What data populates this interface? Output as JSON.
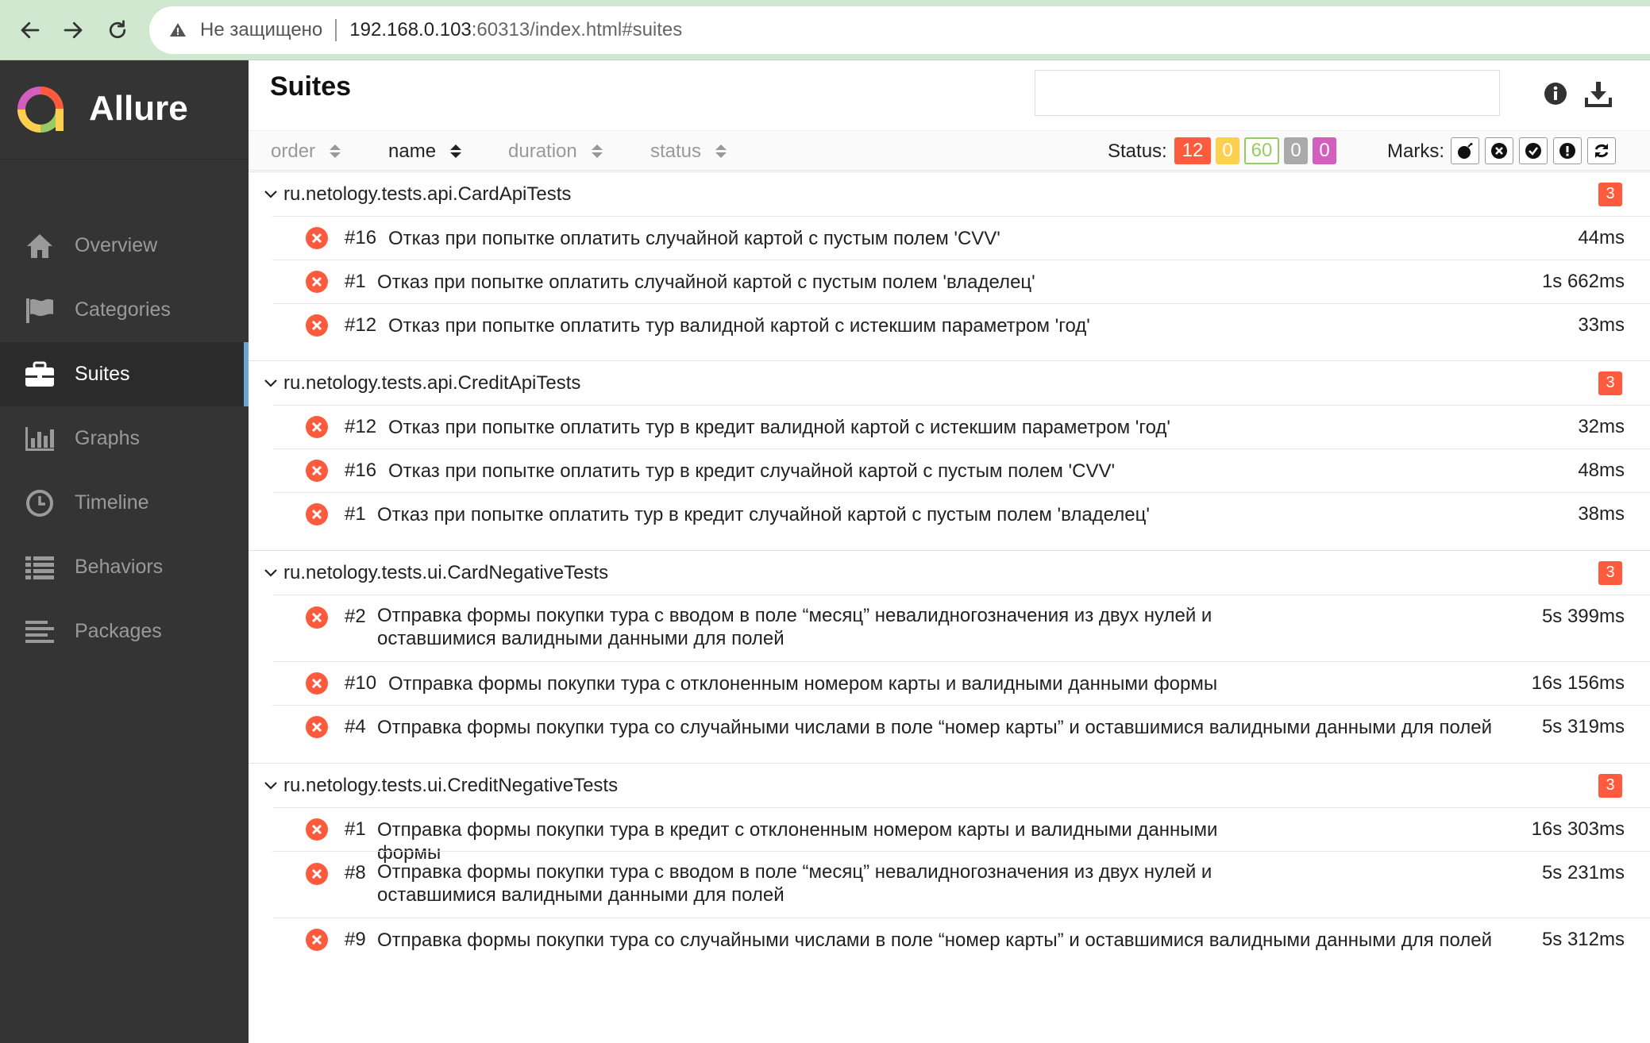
{
  "browser": {
    "not_secure": "Не защищено",
    "url_host": "192.168.0.103",
    "url_rest": ":60313/index.html#suites",
    "icons": [
      "back-icon",
      "forward-icon",
      "reload-icon",
      "warning-icon"
    ]
  },
  "sidebar": {
    "brand": "Allure",
    "items": [
      {
        "label": "Overview",
        "icon": "home-icon"
      },
      {
        "label": "Categories",
        "icon": "flag-icon"
      },
      {
        "label": "Suites",
        "icon": "briefcase-icon"
      },
      {
        "label": "Graphs",
        "icon": "bar-chart-icon"
      },
      {
        "label": "Timeline",
        "icon": "clock-icon"
      },
      {
        "label": "Behaviors",
        "icon": "list-icon"
      },
      {
        "label": "Packages",
        "icon": "align-left-icon"
      }
    ],
    "active": "Suites"
  },
  "header": {
    "title": "Suites",
    "search_value": "",
    "icons": [
      "info-icon",
      "download-icon"
    ]
  },
  "toolbar": {
    "sort": [
      {
        "label": "order"
      },
      {
        "label": "name"
      },
      {
        "label": "duration"
      },
      {
        "label": "status"
      }
    ],
    "active_sort": "name",
    "status_label": "Status:",
    "status_badges": [
      {
        "value": "12",
        "kind": "failed",
        "bg": "#fd5a3e",
        "fg": "#ffffff"
      },
      {
        "value": "0",
        "kind": "broken",
        "bg": "#ffd050",
        "fg": "#ffffff"
      },
      {
        "value": "60",
        "kind": "passed",
        "bg": "#ffffff",
        "fg": "#97cc64",
        "border": "#97cc64"
      },
      {
        "value": "0",
        "kind": "skipped",
        "bg": "#aaaaaa",
        "fg": "#ffffff"
      },
      {
        "value": "0",
        "kind": "unknown",
        "bg": "#d35ebe",
        "fg": "#ffffff"
      }
    ],
    "marks_label": "Marks:",
    "marks": [
      "bomb-icon",
      "times-circle-icon",
      "check-circle-icon",
      "exclamation-circle-icon",
      "refresh-icon"
    ]
  },
  "suites": [
    {
      "name": "ru.netology.tests.api.CardApiTests",
      "count": "3",
      "tests": [
        {
          "order": "#16",
          "name": "Отказ при попытке оплатить случайной картой с пустым полем 'CVV'",
          "duration": "44ms"
        },
        {
          "order": "#1",
          "name": "Отказ при попытке оплатить случайной картой с пустым полем 'владелец'",
          "duration": "1s 662ms"
        },
        {
          "order": "#12",
          "name": "Отказ при попытке оплатить тур валидной картой с истекшим параметром 'год'",
          "duration": "33ms"
        }
      ]
    },
    {
      "name": "ru.netology.tests.api.CreditApiTests",
      "count": "3",
      "tests": [
        {
          "order": "#12",
          "name": "Отказ при попытке оплатить тур в кредит валидной картой с истекшим параметром 'год'",
          "duration": "32ms"
        },
        {
          "order": "#16",
          "name": "Отказ при попытке оплатить тур в кредит случайной картой с пустым полем 'CVV'",
          "duration": "48ms"
        },
        {
          "order": "#1",
          "name": "Отказ при попытке оплатить тур в кредит случайной картой с пустым полем 'владелец'",
          "duration": "38ms"
        }
      ]
    },
    {
      "name": "ru.netology.tests.ui.CardNegativeTests",
      "count": "3",
      "tests": [
        {
          "order": "#2",
          "name": "Отправка формы покупки тура с вводом в поле “месяц” невалидногозначения из двух нулей и оставшимися валидными данными для полей",
          "duration": "5s 399ms"
        },
        {
          "order": "#10",
          "name": "Отправка формы покупки тура с отклоненным номером карты и валидными данными формы",
          "duration": "16s 156ms"
        },
        {
          "order": "#4",
          "name": "Отправка формы покупки тура со случайными числами в поле “номер карты” и оставшимися валидными данными для полей",
          "duration": "5s 319ms"
        }
      ]
    },
    {
      "name": "ru.netology.tests.ui.CreditNegativeTests",
      "count": "3",
      "tests": [
        {
          "order": "#1",
          "name": "Отправка формы покупки тура в кредит с отклоненным номером карты и валидными данными формы",
          "duration": "16s 303ms"
        },
        {
          "order": "#8",
          "name": "Отправка формы покупки тура с вводом в поле “месяц” невалидногозначения из двух нулей и оставшимися валидными данными для полей",
          "duration": "5s 231ms"
        },
        {
          "order": "#9",
          "name": "Отправка формы покупки тура со случайными числами в поле “номер карты” и оставшимися валидными данными для полей",
          "duration": "5s 312ms"
        }
      ]
    }
  ]
}
